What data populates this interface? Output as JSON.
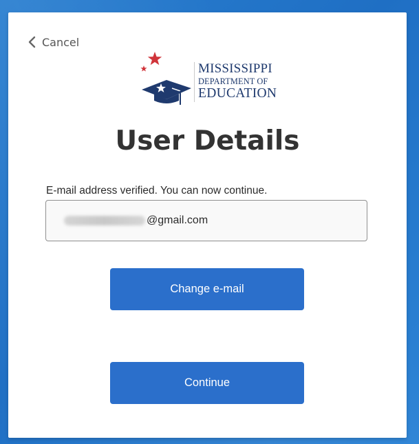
{
  "header": {
    "cancel_label": "Cancel",
    "cancel_icon": "chevron-left-icon"
  },
  "logo": {
    "line1": "MISSISSIPPI",
    "line2": "DEPARTMENT OF",
    "line3": "EDUCATION",
    "icon": "graduation-cap-icon",
    "colors": {
      "navy": "#1f3a6e",
      "red": "#d0343a"
    }
  },
  "page": {
    "title": "User Details",
    "verified_message": "E-mail address verified. You can now continue."
  },
  "email_field": {
    "value_suffix": "@gmail.com",
    "redacted_prefix": true
  },
  "buttons": {
    "change_email_label": "Change e-mail",
    "continue_label": "Continue"
  },
  "colors": {
    "accent": "#2b6fcb",
    "background": "#2a7fd0",
    "card": "#ffffff",
    "title_text": "#333333"
  }
}
